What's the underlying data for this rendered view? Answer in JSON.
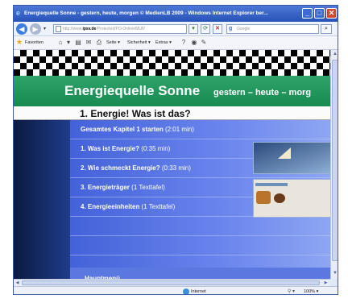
{
  "window": {
    "title": "Energiequelle Sonne - gestern, heute, morgen © MedienLB 2009 - Windows Internet Explorer ber...",
    "minimize_glyph": "_",
    "maximize_glyph": "□",
    "close_glyph": "✕"
  },
  "navbar": {
    "back_glyph": "◀",
    "forward_glyph": "▶",
    "dropdown_glyph": "▾",
    "address_prefix": "http://www.",
    "address_host": "ipsv.de",
    "address_suffix": "/Protected/PO-Online/MLB/",
    "refresh_glyph": "⟳",
    "stop_glyph": "✕",
    "search_engine": "g",
    "search_placeholder": "Google",
    "search_glyph": "⌕"
  },
  "command_bar": {
    "favorites_label": "Favoriten",
    "page_label": "Seite ▾",
    "security_label": "Sicherheit ▾",
    "extras_label": "Extras ▾",
    "icon_glyphs": [
      "⌂",
      "▾",
      "▤",
      "✉",
      "⎙",
      "?",
      "◉",
      "✎"
    ]
  },
  "page": {
    "title": "Energiequelle Sonne",
    "subtitle": "gestern – heute – morg",
    "chapter_heading": "1. Energie! Was ist das?",
    "menu_items": [
      {
        "label": "Gesamtes Kapitel 1 starten",
        "duration": "(2:01 min)"
      },
      {
        "label": "1. Was ist Energie?",
        "duration": "(0:35 min)"
      },
      {
        "label": "2. Wie schmeckt Energie?",
        "duration": "(0:33 min)"
      },
      {
        "label": "3. Energieträger",
        "duration": "(1 Texttafel)"
      },
      {
        "label": "4. Energieeinheiten",
        "duration": "(1 Texttafel)"
      },
      {
        "label": "",
        "duration": ""
      },
      {
        "label": "",
        "duration": ""
      },
      {
        "label": "",
        "duration": ""
      }
    ],
    "main_menu_label": "Hauptmenü"
  },
  "scrollbars": {
    "up_glyph": "▲",
    "down_glyph": "▼",
    "left_glyph": "◀",
    "right_glyph": "▶"
  },
  "status_bar": {
    "zone_label": "Internet",
    "zone_icon_glyph": "⚲ ▾",
    "zoom_label": "100% ▾"
  },
  "colors": {
    "green_band": "#178a52",
    "menu_blue": "#5a78e0",
    "titlebar_blue": "#2752b8"
  }
}
